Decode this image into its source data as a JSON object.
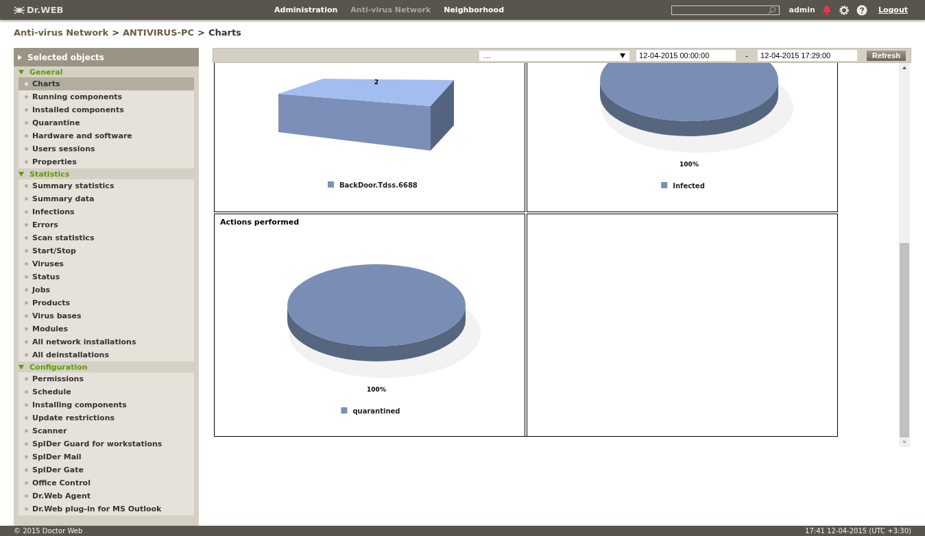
{
  "header": {
    "logo": "Dr.WEB",
    "nav": [
      {
        "label": "Administration",
        "selected": false
      },
      {
        "label": "Anti-virus Network",
        "selected": true
      },
      {
        "label": "Neighborhood",
        "selected": false
      }
    ],
    "user": "admin",
    "logout": "Logout"
  },
  "breadcrumb": [
    "Anti-virus Network",
    ">",
    "ANTIVIRUS-PC",
    ">",
    "Charts"
  ],
  "sidebar": {
    "title": "Selected objects",
    "groups": [
      {
        "label": "General",
        "expanded": true,
        "items": [
          {
            "label": "Charts",
            "selected": true
          },
          {
            "label": "Running components",
            "selected": false
          },
          {
            "label": "Installed components",
            "selected": false
          },
          {
            "label": "Quarantine",
            "selected": false
          },
          {
            "label": "Hardware and software",
            "selected": false
          },
          {
            "label": "Users sessions",
            "selected": false
          },
          {
            "label": "Properties",
            "selected": false
          }
        ]
      },
      {
        "label": "Statistics",
        "expanded": true,
        "items": [
          {
            "label": "Summary statistics",
            "selected": false
          },
          {
            "label": "Summary data",
            "selected": false
          },
          {
            "label": "Infections",
            "selected": false
          },
          {
            "label": "Errors",
            "selected": false
          },
          {
            "label": "Scan statistics",
            "selected": false
          },
          {
            "label": "Start/Stop",
            "selected": false
          },
          {
            "label": "Viruses",
            "selected": false
          },
          {
            "label": "Status",
            "selected": false
          },
          {
            "label": "Jobs",
            "selected": false
          },
          {
            "label": "Products",
            "selected": false
          },
          {
            "label": "Virus bases",
            "selected": false
          },
          {
            "label": "Modules",
            "selected": false
          },
          {
            "label": "All network installations",
            "selected": false
          },
          {
            "label": "All deinstallations",
            "selected": false
          }
        ]
      },
      {
        "label": "Configuration",
        "expanded": true,
        "items": [
          {
            "label": "Permissions",
            "selected": false
          },
          {
            "label": "Schedule",
            "selected": false
          },
          {
            "label": "Installing components",
            "selected": false
          },
          {
            "label": "Update restrictions",
            "selected": false
          },
          {
            "label": "Scanner",
            "selected": false
          },
          {
            "label": "SpIDer Guard for workstations",
            "selected": false
          },
          {
            "label": "SpIDer Mail",
            "selected": false
          },
          {
            "label": "SpIDer Gate",
            "selected": false
          },
          {
            "label": "Office Control",
            "selected": false
          },
          {
            "label": "Dr.Web Agent",
            "selected": false
          },
          {
            "label": "Dr.Web plug-in for MS Outlook",
            "selected": false
          }
        ]
      }
    ]
  },
  "toolbar": {
    "period": "...",
    "from": "12-04-2015 00:00:00",
    "separator": "-",
    "to": "12-04-2015 17:29:00",
    "refresh": "Refresh"
  },
  "panels": [
    {
      "kind": "bar",
      "value_label": "2",
      "legend": "BackDoor.Tdss.6688"
    },
    {
      "kind": "pie",
      "value_label": "100%",
      "legend": "Infected"
    },
    {
      "kind": "pie",
      "title": "Actions performed",
      "value_label": "100%",
      "legend": "quarantined"
    }
  ],
  "footer": {
    "copyright": "© 2015 Doctor Web",
    "datetime": "17:41 12-04-2015 (UTC +3:30)"
  }
}
